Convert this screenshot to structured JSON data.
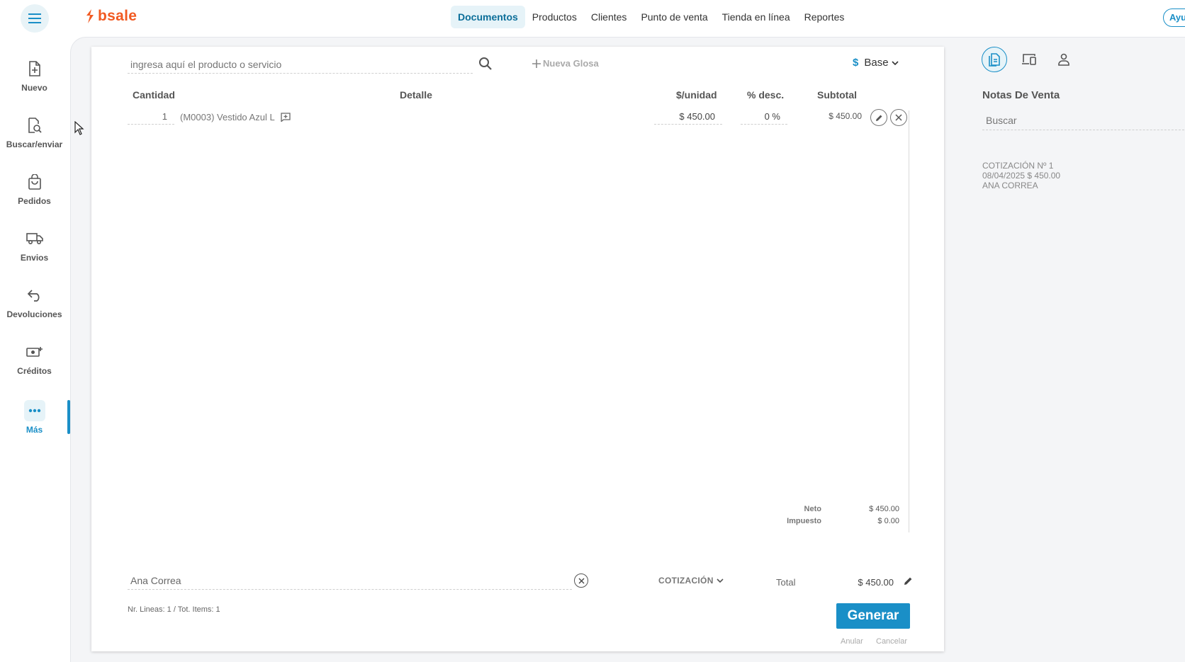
{
  "header": {
    "logo_text": "bsale",
    "nav": [
      {
        "label": "Documentos",
        "active": true
      },
      {
        "label": "Productos"
      },
      {
        "label": "Clientes"
      },
      {
        "label": "Punto de venta"
      },
      {
        "label": "Tienda en línea"
      },
      {
        "label": "Reportes"
      }
    ],
    "help_label": "Ayu"
  },
  "sidebar": {
    "items": [
      {
        "label": "Nuevo",
        "icon": "new-document-icon"
      },
      {
        "label": "Buscar/enviar",
        "icon": "search-document-icon"
      },
      {
        "label": "Pedidos",
        "icon": "shopping-bag-icon"
      },
      {
        "label": "Envios",
        "icon": "truck-icon"
      },
      {
        "label": "Devoluciones",
        "icon": "return-arrow-icon"
      },
      {
        "label": "Créditos",
        "icon": "credit-cash-icon"
      },
      {
        "label": "Más",
        "icon": "more-dots-icon",
        "active": true
      }
    ]
  },
  "document": {
    "search_placeholder": "ingresa aquí el producto o servicio",
    "nueva_glosa": "Nueva Glosa",
    "price_list": {
      "symbol": "$",
      "label": "Base"
    },
    "columns": {
      "cantidad": "Cantidad",
      "detalle": "Detalle",
      "unidad": "$/unidad",
      "desc": "% desc.",
      "subtotal": "Subtotal"
    },
    "lines": [
      {
        "qty": "1",
        "detail": "(M0003) Vestido Azul L",
        "unit_price": "$ 450.00",
        "discount": "0 %",
        "subtotal": "$ 450.00"
      }
    ],
    "totals": {
      "neto_label": "Neto",
      "neto_value": "$ 450.00",
      "impuesto_label": "Impuesto",
      "impuesto_value": "$ 0.00",
      "total_label": "Total",
      "total_value": "$ 450.00"
    },
    "client_value": "Ana Correa",
    "doc_type": "COTIZACIÓN",
    "summary": "Nr. Lineas: 1 / Tot. Items: 1",
    "generate_label": "Generar",
    "anular_label": "Anular",
    "cancelar_label": "Cancelar"
  },
  "right_panel": {
    "title": "Notas De Venta",
    "search_placeholder": "Buscar",
    "notes": [
      {
        "line1": "COTIZACIÓN Nº 1",
        "line2": "08/04/2025 $ 450.00",
        "line3": "ANA CORREA"
      }
    ]
  },
  "colors": {
    "accent": "#1a8fc7",
    "brand": "#f15a22"
  }
}
